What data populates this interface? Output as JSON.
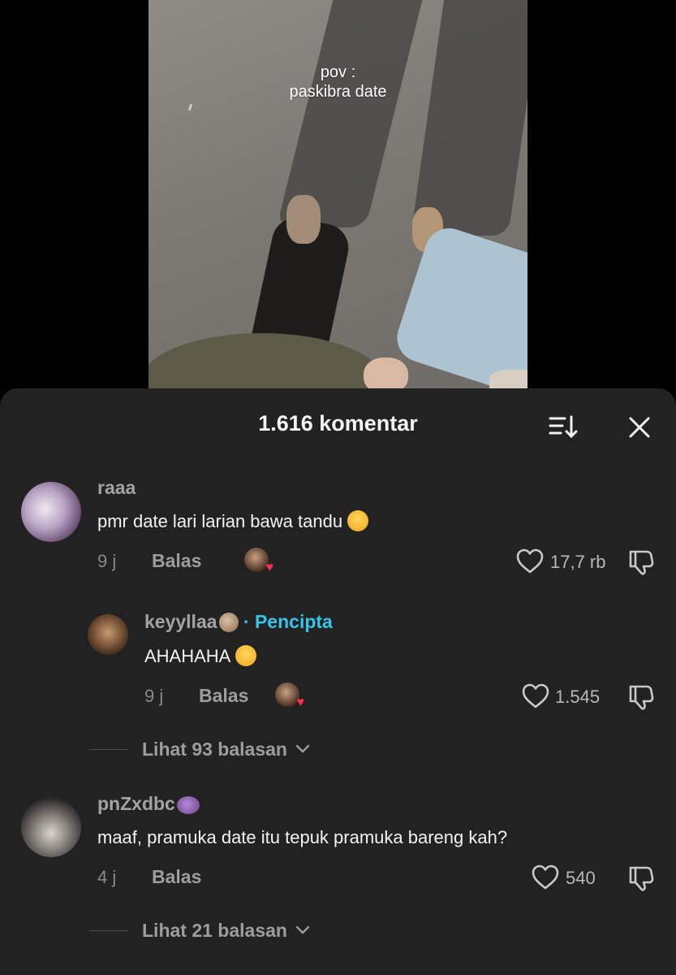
{
  "video": {
    "overlay_line1": "pov :",
    "overlay_line2": "paskibra date"
  },
  "sheet": {
    "title": "1.616 komentar",
    "sort_icon": "sort-icon",
    "close_icon": "close-icon"
  },
  "comments": [
    {
      "username": "raaa",
      "text": "pmr date lari larian bawa tandu",
      "emoji": "loudly-crying-face",
      "time": "9 j",
      "reply_label": "Balas",
      "likes": "17,7 rb",
      "liked_by_creator": true
    },
    {
      "username": "keyyllaa",
      "username_emoji": "shell",
      "badge": "· Pencipta",
      "text": "AHAHAHA",
      "emoji": "face-with-hand-over-mouth",
      "time": "9 j",
      "reply_label": "Balas",
      "likes": "1.545",
      "liked_by_creator": true,
      "is_reply": true
    },
    {
      "view_replies": "Lihat 93 balasan"
    },
    {
      "username": "pnZxdbc",
      "username_emoji": "ringed-planet",
      "text": "maaf, pramuka date itu tepuk pramuka bareng kah?",
      "time": "4 j",
      "reply_label": "Balas",
      "likes": "540",
      "liked_by_creator": false
    },
    {
      "view_replies": "Lihat 21 balasan"
    }
  ],
  "colors": {
    "sheet_bg": "#222222",
    "creator_badge": "#35c5e7",
    "heart_accent": "#fe2c55"
  }
}
